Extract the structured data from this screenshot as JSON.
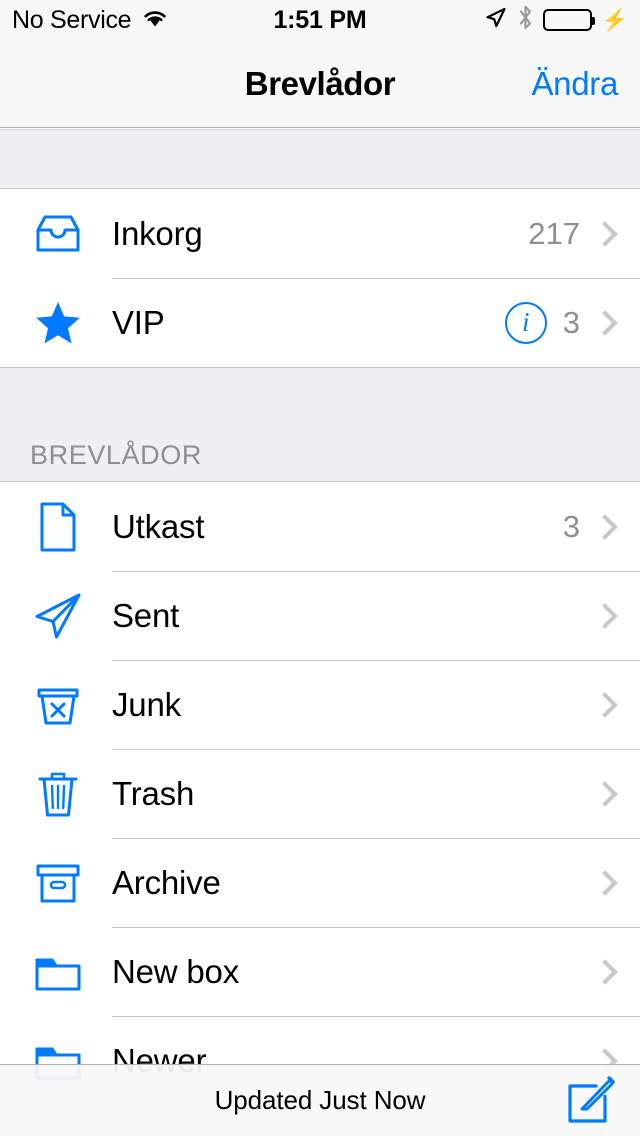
{
  "status_bar": {
    "carrier": "No Service",
    "wifi_icon": "wifi-icon",
    "time": "1:51 PM",
    "location_icon": "location-arrow-icon",
    "bluetooth_icon": "bluetooth-icon",
    "battery_icon": "battery-full-icon",
    "charging_icon": "charging-bolt-icon",
    "battery_level_percent": 100,
    "battery_color": "#4cd964"
  },
  "nav": {
    "title": "Brevlådor",
    "edit_label": "Ändra"
  },
  "colors": {
    "accent": "#007aff",
    "separator": "#c8c7cc",
    "section_bg": "#efeff4",
    "secondary_text": "#8e8e93"
  },
  "sections": [
    {
      "header": "",
      "rows": [
        {
          "icon": "inbox-tray-icon",
          "label": "Inkorg",
          "count": "217",
          "info_button": false
        },
        {
          "icon": "star-icon",
          "label": "VIP",
          "count": "3",
          "info_button": true,
          "info_glyph": "i"
        }
      ]
    },
    {
      "header": "BREVLÅDOR",
      "rows": [
        {
          "icon": "document-page-icon",
          "label": "Utkast",
          "count": "3",
          "info_button": false
        },
        {
          "icon": "paper-plane-icon",
          "label": "Sent",
          "count": "",
          "info_button": false
        },
        {
          "icon": "junk-bin-x-icon",
          "label": "Junk",
          "count": "",
          "info_button": false
        },
        {
          "icon": "trash-can-icon",
          "label": "Trash",
          "count": "",
          "info_button": false
        },
        {
          "icon": "archive-box-icon",
          "label": "Archive",
          "count": "",
          "info_button": false
        },
        {
          "icon": "folder-icon",
          "label": "New box",
          "count": "",
          "info_button": false
        },
        {
          "icon": "folder-icon",
          "label": "Newer",
          "count": "",
          "info_button": false
        }
      ]
    }
  ],
  "toolbar": {
    "status_text": "Updated Just Now",
    "compose_icon": "compose-pencil-icon"
  }
}
